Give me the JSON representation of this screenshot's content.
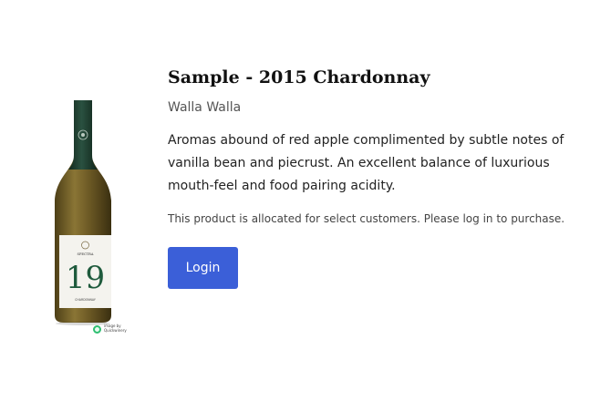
{
  "product": {
    "title": "Sample - 2015 Chardonnay",
    "region": "Walla Walla",
    "description": "Aromas abound of red apple complimented by subtle notes of vanilla bean and piecrust. An excellent balance of luxurious mouth-feel and food pairing acidity.",
    "allocation_notice": "This product is allocated for select customers. Please log in to purchase."
  },
  "actions": {
    "login_label": "Login"
  },
  "bottle_label": {
    "brand": "SPECTRA",
    "number": "19",
    "varietal": "CHARDONNAY"
  },
  "image_credit": {
    "line1": "image by",
    "line2": "Quickwinery"
  },
  "colors": {
    "button": "#3b5fd8",
    "bottle_capsule": "#1f3d2e",
    "wine": "#6b5a2a",
    "label_number": "#1e5a3c"
  }
}
